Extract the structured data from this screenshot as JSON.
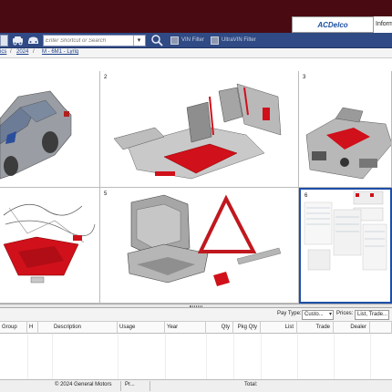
{
  "header": {
    "brand_logo": "ACDelco",
    "info_tab": "Inform"
  },
  "toolbar": {
    "search_placeholder": "Enter Shortcut or Search",
    "vin_filter_label": "VIN Filter",
    "ultravin_filter_label": "UltraVIN Filter",
    "icons": [
      "vehicle-icon",
      "car-front-icon",
      "search-zoom-icon"
    ]
  },
  "breadcrumb": {
    "item0": "ics",
    "sep1": "/",
    "item1": "2024",
    "sep2": "/",
    "item2": "M - 6M1 - Lyriq"
  },
  "illustrations": [
    {
      "number": "",
      "subject": "vehicle body"
    },
    {
      "number": "2",
      "subject": "seats"
    },
    {
      "number": "3",
      "subject": "engine compartment"
    },
    {
      "number": "",
      "subject": "wiring harness"
    },
    {
      "number": "5",
      "subject": "seat frame and warning triangle"
    },
    {
      "number": "6",
      "subject": "diagrams"
    }
  ],
  "filterbar": {
    "pay_type_label": "Pay Type:",
    "pay_type_value": "Custo...",
    "prices_label": "Prices:",
    "prices_value": "List, Trade..."
  },
  "table": {
    "columns": [
      "Group",
      "H",
      "Description",
      "Usage",
      "Year",
      "Qty",
      "Pkg Qty",
      "List",
      "Trade",
      "Dealer"
    ]
  },
  "footer": {
    "copyright": "© 2024 General Motors",
    "middle": "Pr...",
    "total_label": "Total:"
  },
  "colors": {
    "header_bg": "#4a0a12",
    "toolbar_bg": "#2f4a84",
    "highlight_red": "#d0101a"
  }
}
